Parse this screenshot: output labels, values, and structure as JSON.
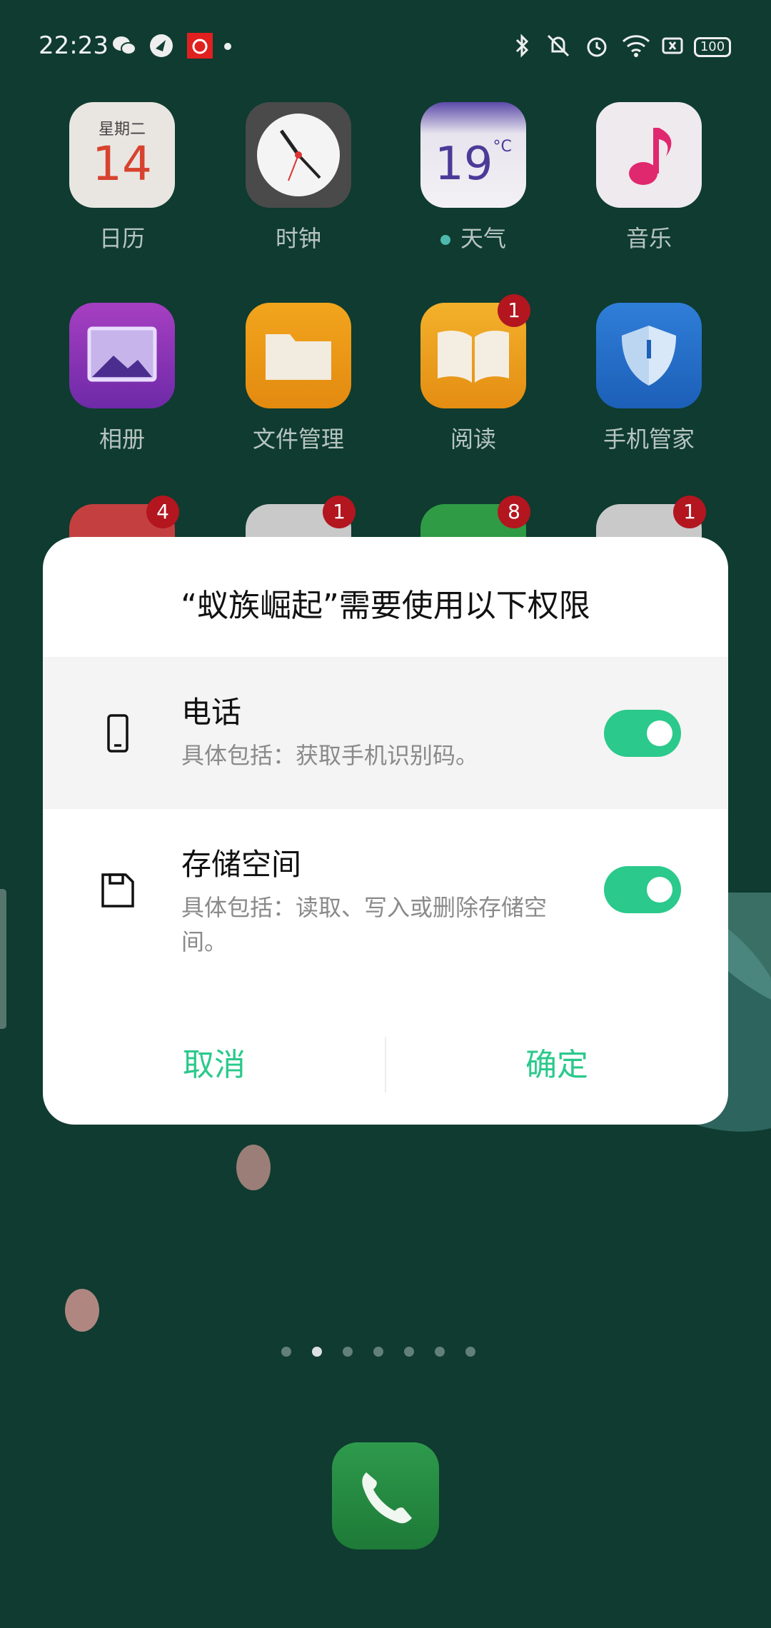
{
  "status_bar": {
    "time": "22:23",
    "battery": "100",
    "left_icons": [
      "wechat-icon",
      "app-icon",
      "netease-music-icon",
      "notification-dot-icon"
    ],
    "right_icons": [
      "bluetooth-icon",
      "mute-icon",
      "alarm-icon",
      "wifi-icon",
      "sim-icon",
      "battery-icon"
    ]
  },
  "apps": [
    {
      "label": "日历",
      "icon": "calendar-icon",
      "week": "星期二",
      "day": "14"
    },
    {
      "label": "时钟",
      "icon": "clock-icon"
    },
    {
      "label": "天气",
      "icon": "weather-icon",
      "temp": "19",
      "unit": "°C"
    },
    {
      "label": "音乐",
      "icon": "music-icon"
    },
    {
      "label": "相册",
      "icon": "gallery-icon"
    },
    {
      "label": "文件管理",
      "icon": "folder-icon"
    },
    {
      "label": "阅读",
      "icon": "book-icon",
      "badge": "1"
    },
    {
      "label": "手机管家",
      "icon": "shield-icon"
    },
    {
      "badge": "4",
      "icon": "app-icon"
    },
    {
      "badge": "1",
      "icon": "app-icon"
    },
    {
      "badge": "8",
      "icon": "app-icon"
    },
    {
      "badge": "1",
      "icon": "app-icon"
    }
  ],
  "dialog": {
    "title": "“蚁族崛起”需要使用以下权限",
    "permissions": [
      {
        "title": "电话",
        "desc": "具体包括：获取手机识别码。",
        "enabled": true,
        "icon": "phone-icon"
      },
      {
        "title": "存储空间",
        "desc": "具体包括：读取、写入或删除存储空间。",
        "enabled": true,
        "icon": "save-icon"
      }
    ],
    "cancel_label": "取消",
    "confirm_label": "确定"
  },
  "colors": {
    "accent": "#2bc98b",
    "badge": "#b3161f",
    "wallpaper": "#123f34"
  },
  "page_indicator": {
    "count": 7,
    "active_index": 1
  },
  "dock": {
    "icon": "phone-call-icon"
  }
}
